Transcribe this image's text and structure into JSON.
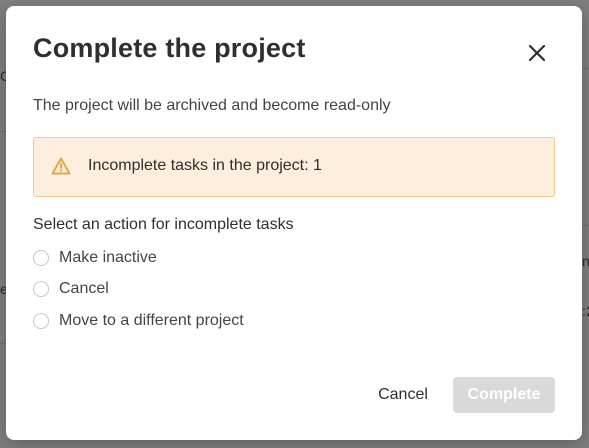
{
  "background": {
    "fragment_left_1": "C",
    "fragment_left_2": "e",
    "fragment_right_1": "nc",
    "fragment_right_2": ":2"
  },
  "dialog": {
    "title": "Complete the project",
    "close_icon": "close-icon",
    "subtitle": "The project will be archived and become read-only",
    "warning": {
      "icon": "warning-icon",
      "text": "Incomplete tasks in the project: 1",
      "bg_color": "#fdeedd",
      "border_color": "#f0c98f",
      "icon_color": "#e2a33a"
    },
    "section_label": "Select an action for incomplete tasks",
    "options": [
      {
        "label": "Make inactive",
        "selected": false
      },
      {
        "label": "Cancel",
        "selected": false
      },
      {
        "label": "Move to a different project",
        "selected": false
      }
    ],
    "buttons": {
      "cancel_label": "Cancel",
      "complete_label": "Complete",
      "complete_disabled": true
    }
  }
}
